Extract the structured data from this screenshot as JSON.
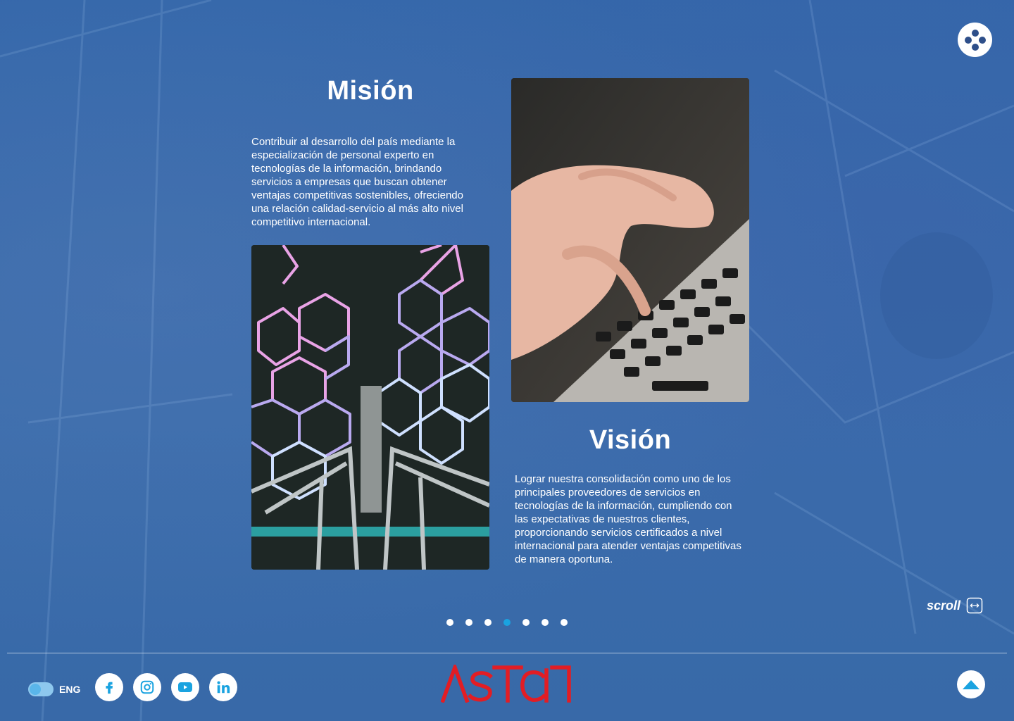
{
  "mision": {
    "title": "Misión",
    "text": "Contribuir al desarrollo del país mediante la especialización de personal experto en tecnologías de la información, brindando servicios a empresas que buscan obtener ventajas competitivas sostenibles, ofreciendo una relación calidad-servicio al más alto nivel competitivo internacional."
  },
  "vision": {
    "title": "Visión",
    "text": "Lograr nuestra consolidación como uno de los principales proveedores de servicios en tecnologías de la información, cumpliendo con las expectativas de nuestros clientes, proporcionando servicios certificados a nivel internacional para atender ventajas competitivas de manera oportuna."
  },
  "carousel": {
    "dot_count": 7,
    "active_index": 3
  },
  "scroll_label": "scroll",
  "language": {
    "label": "ENG"
  },
  "social": [
    "facebook-icon",
    "instagram-icon",
    "youtube-icon",
    "linkedin-icon"
  ],
  "brand": {
    "logo_text": "AsTecI",
    "logo_color": "#e21d24",
    "accent": "#1aa3e0",
    "background": "#3a6aa9"
  }
}
